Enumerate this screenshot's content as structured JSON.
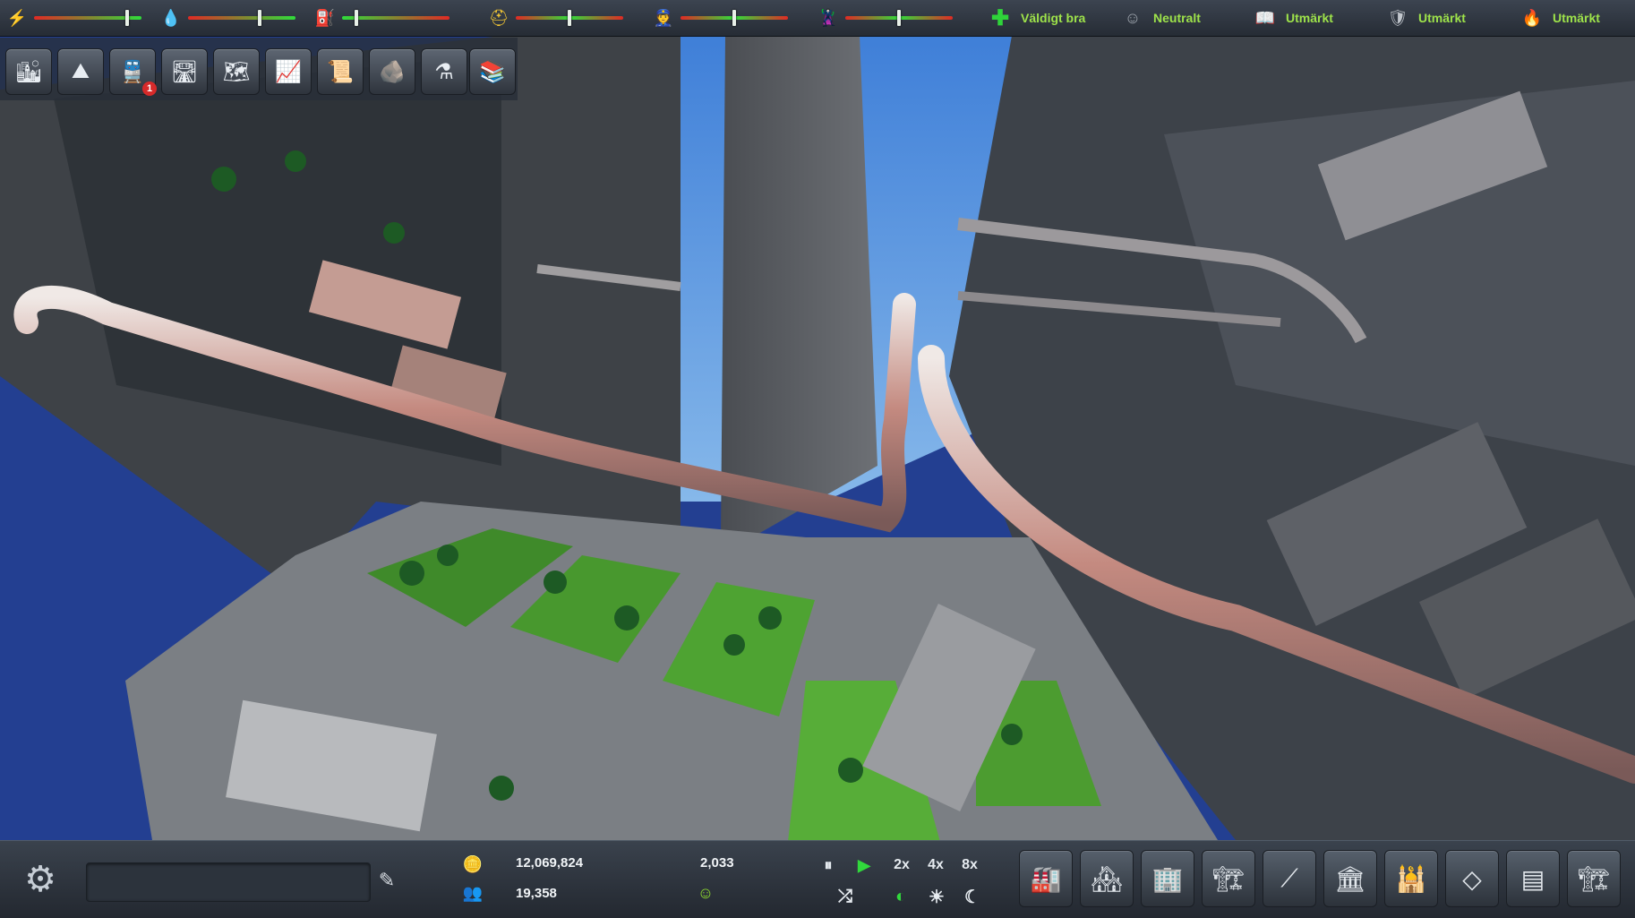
{
  "topbar": {
    "meters": [
      {
        "icon": "lightning-icon",
        "level": 0.85
      },
      {
        "icon": "water-drop-icon",
        "level": 0.65
      },
      {
        "icon": "fuel-canister-icon",
        "level": 0.12
      },
      {
        "icon": "worker-hardhat-icon",
        "level": 0.5
      },
      {
        "icon": "police-officer-icon",
        "level": 0.5
      },
      {
        "icon": "criminal-mask-icon",
        "level": 0.5
      }
    ],
    "statuses": [
      {
        "icon": "health-cross-icon",
        "label": "Väldigt bra"
      },
      {
        "icon": "happiness-face-icon",
        "label": "Neutralt"
      },
      {
        "icon": "education-book-icon",
        "label": "Utmärkt"
      },
      {
        "icon": "security-shield-icon",
        "label": "Utmärkt"
      },
      {
        "icon": "fire-safety-icon",
        "label": "Utmärkt"
      }
    ]
  },
  "tools": [
    {
      "icon": "city-overview-icon",
      "badge": ""
    },
    {
      "icon": "terrain-icon",
      "badge": ""
    },
    {
      "icon": "transport-icon",
      "badge": "1"
    },
    {
      "icon": "roads-icon",
      "badge": ""
    },
    {
      "icon": "map-icon",
      "badge": ""
    },
    {
      "icon": "statistics-chart-icon",
      "badge": ""
    },
    {
      "icon": "scroll-document-icon",
      "badge": ""
    },
    {
      "icon": "mineral-rock-icon",
      "badge": ""
    },
    {
      "icon": "research-flask-icon",
      "badge": ""
    },
    {
      "icon": "library-books-icon",
      "badge": ""
    }
  ],
  "bottombar": {
    "menu_icon": "settings-tools-icon",
    "city_name_placeholder": "",
    "money": "12,069,824",
    "population": "19,358",
    "date_value": "2,033",
    "mood_icon": "smiley-face-icon",
    "speeds": {
      "pause": "⏸",
      "play": "▶",
      "x2": "2x",
      "x4": "4x",
      "x8": "8x"
    },
    "build_categories": [
      "power-plant-icon",
      "residential-icon",
      "commercial-icon",
      "industrial-icon",
      "transport-ramp-icon",
      "services-icon",
      "landmark-dome-icon",
      "structure-frame-icon",
      "storage-icon",
      "construction-crane-icon"
    ]
  },
  "colors": {
    "accent_green": "#9ee34a",
    "bar_red": "#e12a24",
    "bar_green": "#2fdc3a"
  }
}
